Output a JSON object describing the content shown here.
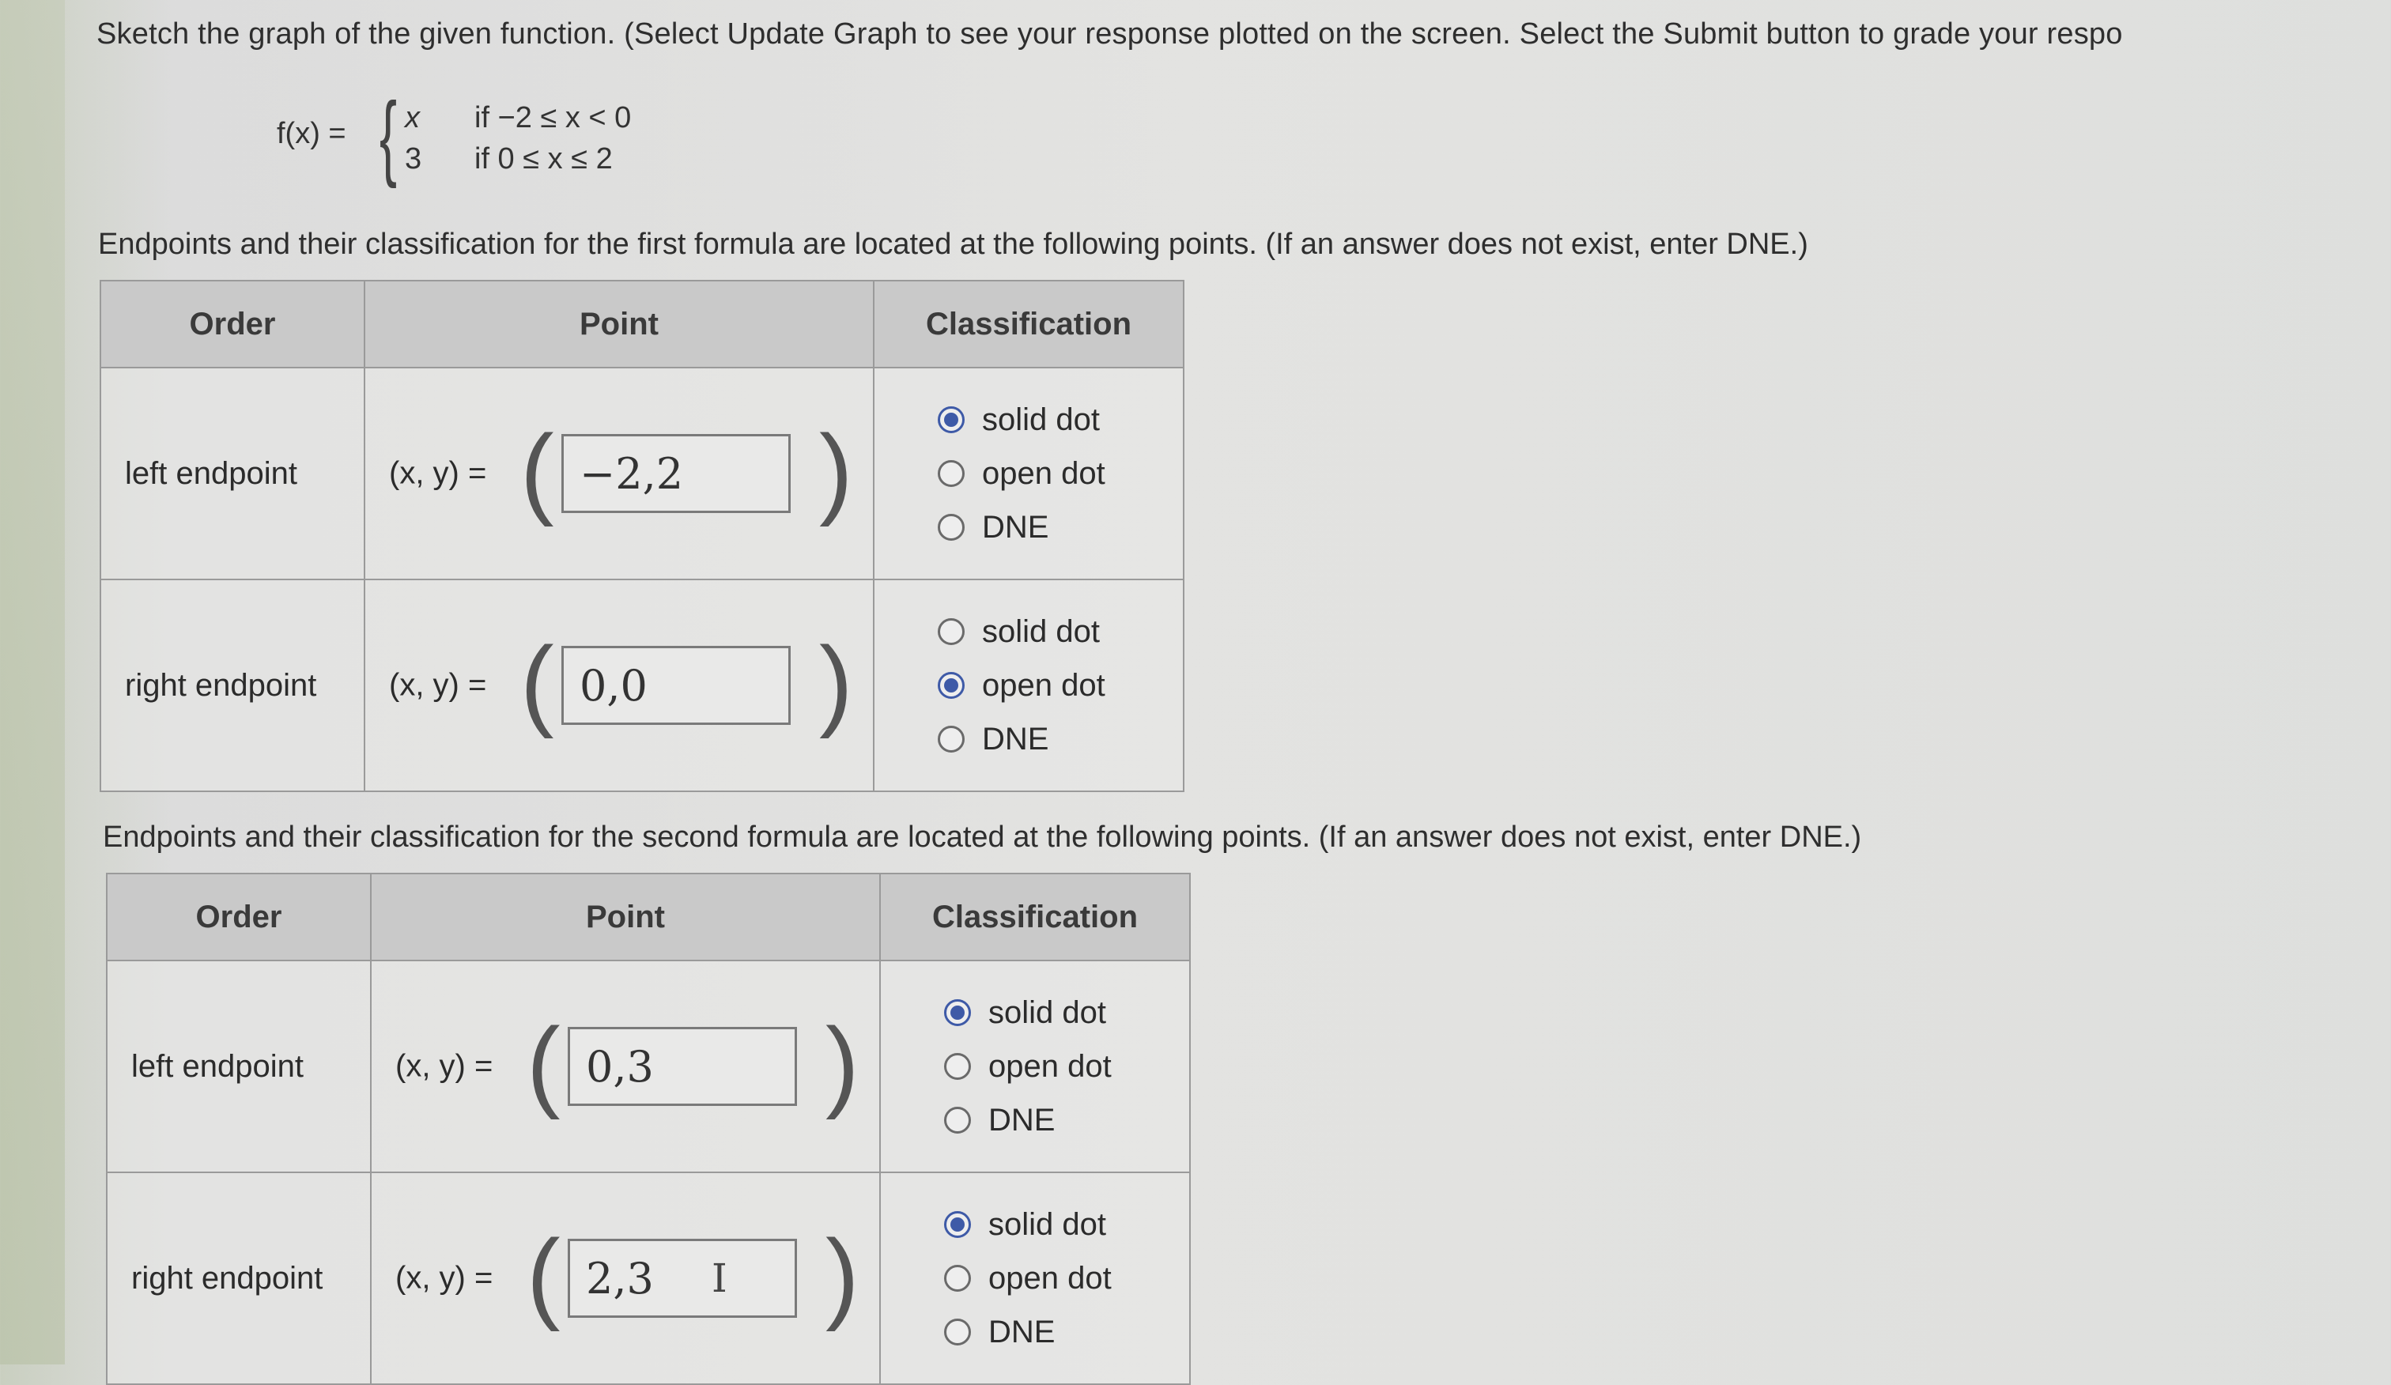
{
  "instructions": "Sketch the graph of the given function. (Select Update Graph to see your response plotted on the screen. Select the Submit button to grade your respo",
  "function": {
    "lhs": "f(x) =",
    "piece1_expr": "x",
    "piece1_cond": "if −2 ≤ x < 0",
    "piece2_expr": "3",
    "piece2_cond": "if 0 ≤ x ≤ 2"
  },
  "first_prompt": "Endpoints and their classification for the first formula are located at the following points. (If an answer does not exist, enter DNE.)",
  "second_prompt": "Endpoints and their classification for the second formula are located at the following points. (If an answer does not exist, enter DNE.)",
  "headers": {
    "order": "Order",
    "point": "Point",
    "classification": "Classification"
  },
  "xy_label": "(x, y) =",
  "option_labels": {
    "solid": "solid dot",
    "open": "open dot",
    "dne": "DNE"
  },
  "table1": [
    {
      "order": "left endpoint",
      "value": "−2,2",
      "selected": "solid dot"
    },
    {
      "order": "right endpoint",
      "value": "0,0",
      "selected": "open dot"
    }
  ],
  "table2": [
    {
      "order": "left endpoint",
      "value": "0,3",
      "selected": "solid dot"
    },
    {
      "order": "right endpoint",
      "value": "2,3",
      "selected": "solid dot"
    }
  ],
  "colors": {
    "radio_selected": "#3e5aa7",
    "header_bg": "#c9c9c9"
  }
}
